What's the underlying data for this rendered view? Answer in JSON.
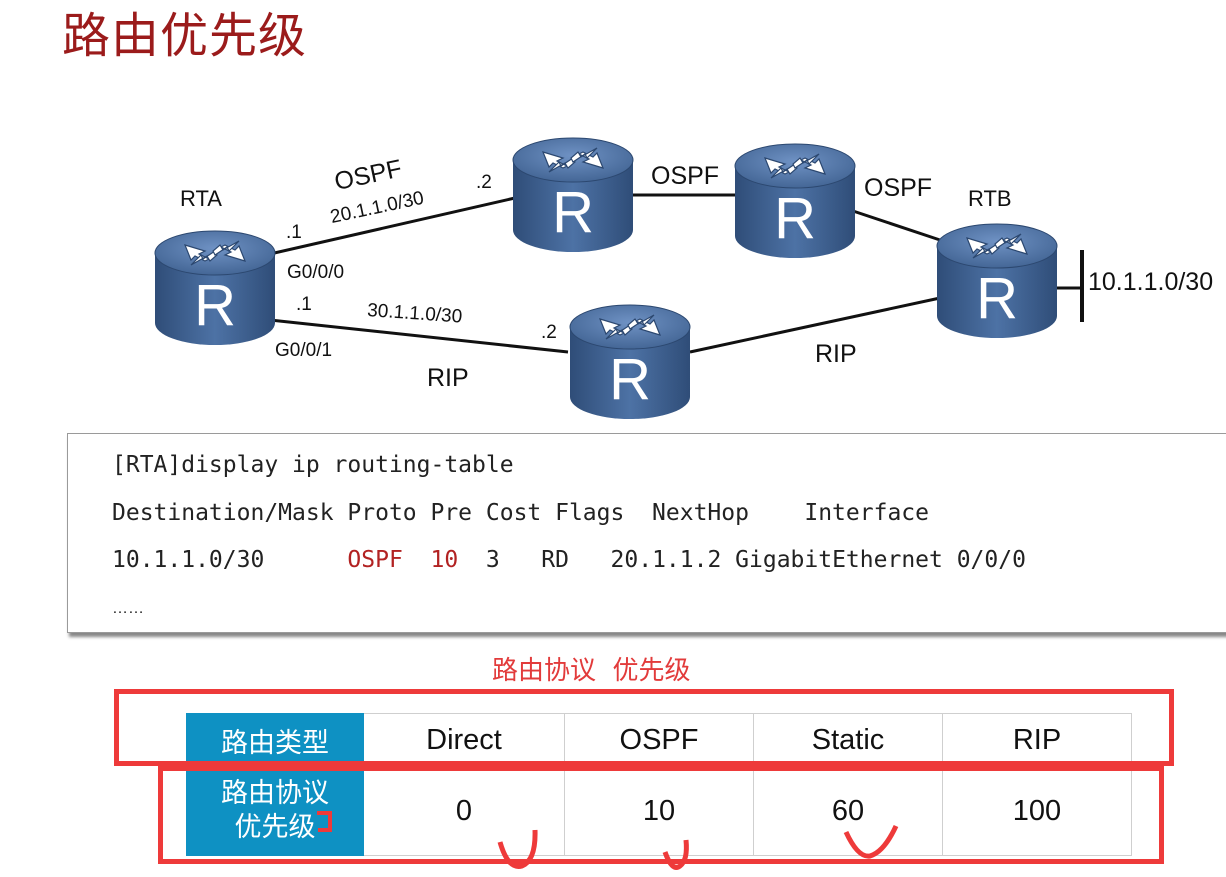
{
  "title": "路由优先级",
  "topology": {
    "routers": [
      {
        "id": "rta",
        "label": "RTA",
        "glyph": "R"
      },
      {
        "id": "top-left",
        "label": "",
        "glyph": "R"
      },
      {
        "id": "top-right",
        "label": "",
        "glyph": "R"
      },
      {
        "id": "bottom",
        "label": "",
        "glyph": "R"
      },
      {
        "id": "rtb",
        "label": "RTB",
        "glyph": "R"
      }
    ],
    "labels": {
      "rta": "RTA",
      "rtb": "RTB",
      "ospf1": "OSPF",
      "ospf2": "OSPF",
      "ospf3": "OSPF",
      "rip1": "RIP",
      "rip2": "RIP",
      "net_top": "20.1.1.0/30",
      "net_bottom": "30.1.1.0/30",
      "net_rtb": "10.1.1.0/30",
      "top_a": ".1",
      "top_b": ".2",
      "bot_a": ".1",
      "bot_b": ".2",
      "if_top": "G0/0/0",
      "if_bottom": "G0/0/1"
    }
  },
  "cli": {
    "command": "[RTA]display ip routing-table",
    "header": "Destination/Mask Proto Pre Cost Flags  NextHop    Interface",
    "row_dest": "10.1.1.0/30      ",
    "row_proto": "OSPF",
    "row_pre": "10",
    "row_rest": "  3   RD   20.1.1.2 GigabitEthernet 0/0/0",
    "ellipsis": "……"
  },
  "caption": "路由协议  优先级",
  "table": {
    "header_label": "路由类型",
    "types": [
      "Direct",
      "OSPF",
      "Static",
      "RIP"
    ],
    "value_label": "路由协议\n优先级",
    "values": [
      "0",
      "10",
      "60",
      "100"
    ]
  },
  "colors": {
    "title": "#9b1b1b",
    "router_fill": "#3d5f8e",
    "accent_red": "#ee3a3a",
    "header_blue": "#0e91c3"
  }
}
